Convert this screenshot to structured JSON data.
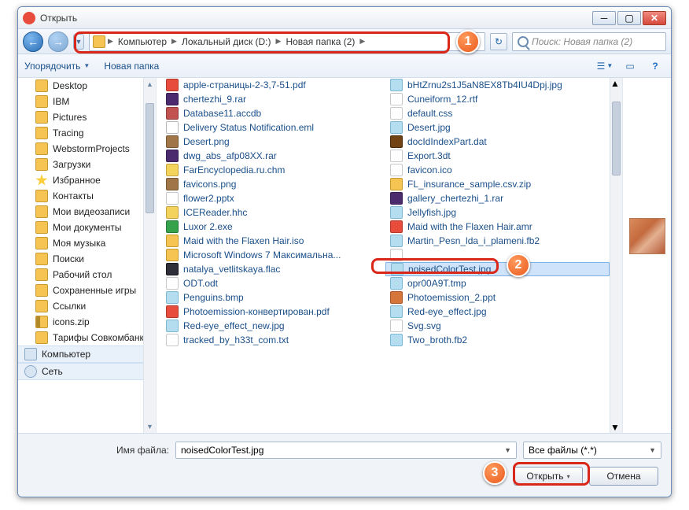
{
  "window": {
    "title": "Открыть"
  },
  "breadcrumbs": {
    "root_icon": "computer-icon",
    "items": [
      "Компьютер",
      "Локальный диск (D:)",
      "Новая папка (2)"
    ]
  },
  "search": {
    "placeholder": "Поиск: Новая папка (2)"
  },
  "toolbar": {
    "organize": "Упорядочить",
    "newfolder": "Новая папка"
  },
  "sidebar": {
    "items": [
      {
        "label": "Desktop",
        "icon": "ic-folder"
      },
      {
        "label": "IBM",
        "icon": "ic-folder"
      },
      {
        "label": "Pictures",
        "icon": "ic-folder"
      },
      {
        "label": "Tracing",
        "icon": "ic-folder"
      },
      {
        "label": "WebstormProjects",
        "icon": "ic-folder"
      },
      {
        "label": "Загрузки",
        "icon": "ic-folder"
      },
      {
        "label": "Избранное",
        "icon": "ic-star"
      },
      {
        "label": "Контакты",
        "icon": "ic-folder"
      },
      {
        "label": "Мои видеозаписи",
        "icon": "ic-folder"
      },
      {
        "label": "Мои документы",
        "icon": "ic-folder"
      },
      {
        "label": "Моя музыка",
        "icon": "ic-folder"
      },
      {
        "label": "Поиски",
        "icon": "ic-folder"
      },
      {
        "label": "Рабочий стол",
        "icon": "ic-folder"
      },
      {
        "label": "Сохраненные игры",
        "icon": "ic-folder"
      },
      {
        "label": "Ссылки",
        "icon": "ic-folder"
      },
      {
        "label": "icons.zip",
        "icon": "ic-zip"
      },
      {
        "label": "Тарифы Совкомбанк",
        "icon": "ic-folder"
      }
    ],
    "roots": [
      {
        "label": "Компьютер",
        "icon": "ic-computer"
      },
      {
        "label": "Сеть",
        "icon": "ic-net"
      }
    ]
  },
  "files": {
    "col1": [
      {
        "name": "apple-страницы-2-3,7-51.pdf",
        "ic": "pdf"
      },
      {
        "name": "chertezhi_9.rar",
        "ic": "rar"
      },
      {
        "name": "Database11.accdb",
        "ic": "db"
      },
      {
        "name": "Delivery Status Notification.eml",
        "ic": "mail"
      },
      {
        "name": "Desert.png",
        "ic": "png"
      },
      {
        "name": "dwg_abs_afp08XX.rar",
        "ic": "rar"
      },
      {
        "name": "FarEncyclopedia.ru.chm",
        "ic": "chm"
      },
      {
        "name": "favicons.png",
        "ic": "png"
      },
      {
        "name": "flower2.pptx",
        "ic": "pptx"
      },
      {
        "name": "ICEReader.hhc",
        "ic": "hhc"
      },
      {
        "name": "Luxor 2.exe",
        "ic": "exe"
      },
      {
        "name": "Maid with the Flaxen Hair.iso",
        "ic": "iso"
      },
      {
        "name": "Microsoft Windows 7 Максимальна...",
        "ic": "iso"
      },
      {
        "name": "natalya_vetlitskaya.flac",
        "ic": "flac"
      },
      {
        "name": "ODT.odt",
        "ic": "odt"
      },
      {
        "name": "Penguins.bmp",
        "ic": "bmp"
      },
      {
        "name": "Photoemission-конвертирован.pdf",
        "ic": "pdf"
      },
      {
        "name": "Red-eye_effect_new.jpg",
        "ic": "jpg"
      },
      {
        "name": "tracked_by_h33t_com.txt",
        "ic": "txt"
      }
    ],
    "col2": [
      {
        "name": "bHtZrnu2s1J5aN8EX8Tb4IU4Dpj.jpg",
        "ic": "jpg"
      },
      {
        "name": "Cuneiform_12.rtf",
        "ic": "rtf"
      },
      {
        "name": "default.css",
        "ic": "css"
      },
      {
        "name": "Desert.jpg",
        "ic": "jpg"
      },
      {
        "name": "docIdIndexPart.dat",
        "ic": "dat"
      },
      {
        "name": "Export.3dt",
        "ic": "tdt"
      },
      {
        "name": "favicon.ico",
        "ic": "ico"
      },
      {
        "name": "FL_insurance_sample.csv.zip",
        "ic": "zip"
      },
      {
        "name": "gallery_chertezhi_1.rar",
        "ic": "rar"
      },
      {
        "name": "Jellyfish.jpg",
        "ic": "jpg"
      },
      {
        "name": "Maid with the Flaxen Hair.amr",
        "ic": "amr"
      },
      {
        "name": "Martin_Pesn_lda_i_plameni.fb2",
        "ic": "fb2"
      },
      {
        "name": "",
        "ic": "txt"
      },
      {
        "name": "noisedColorTest.jpg",
        "ic": "jpg",
        "selected": true
      },
      {
        "name": "opr00A9T.tmp",
        "ic": "tmp"
      },
      {
        "name": "Photoemission_2.ppt",
        "ic": "ppt"
      },
      {
        "name": "Red-eye_effect.jpg",
        "ic": "jpg"
      },
      {
        "name": "Svg.svg",
        "ic": "svg"
      },
      {
        "name": "Two_broth.fb2",
        "ic": "fb2"
      }
    ]
  },
  "bottom": {
    "filename_label": "Имя файла:",
    "filename_value": "noisedColorTest.jpg",
    "filter_value": "Все файлы (*.*)",
    "open": "Открыть",
    "cancel": "Отмена"
  },
  "callouts": {
    "c1": "1",
    "c2": "2",
    "c3": "3"
  }
}
